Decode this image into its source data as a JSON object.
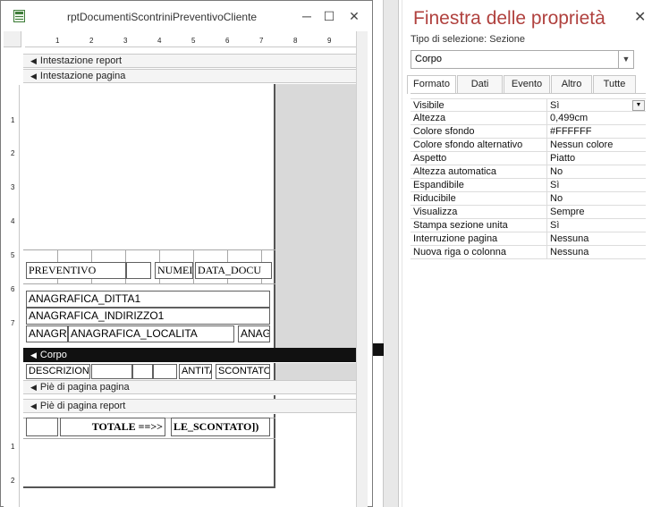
{
  "report_window": {
    "title": "rptDocumentiScontriniPreventivoCliente",
    "minimize_glyph": "─",
    "maximize_glyph": "☐",
    "close_glyph": "✕",
    "icon": "form-icon",
    "ruler_h": [
      "1",
      "2",
      "3",
      "4",
      "5",
      "6",
      "7",
      "8",
      "9"
    ],
    "ruler_v": [
      "1",
      "2",
      "3",
      "4",
      "5",
      "6",
      "7",
      "1",
      "2"
    ],
    "sections": {
      "intestazione_report": "Intestazione report",
      "intestazione_pagina": "Intestazione pagina",
      "corpo": "Corpo",
      "pie_pagina_pagina": "Piè di pagina pagina",
      "pie_pagina_report": "Piè di pagina report"
    },
    "controls": {
      "preventivo": "PREVENTIVO",
      "numero": "NUMEI",
      "data_documento": "DATA_DOCU",
      "ditta": "ANAGRAFICA_DITTA1",
      "indirizzo": "ANAGRAFICA_INDIRIZZO1",
      "anagr_short": "ANAGR",
      "localita": "ANAGRAFICA_LOCALITA",
      "anag_right": "ANAG",
      "descrizione": "DESCRIZIONE_breve",
      "quantita": "ANTITA",
      "scontato": "SCONTATO",
      "totale_label": "TOTALE ==>>",
      "totale_value": "LE_SCONTATO])"
    }
  },
  "property_sheet": {
    "title": "Finestra delle proprietà",
    "close_glyph": "✕",
    "selection_label": "Tipo di selezione:  Sezione",
    "selected_object": "Corpo",
    "tabs": [
      "Formato",
      "Dati",
      "Evento",
      "Altro",
      "Tutte"
    ],
    "active_tab": "Formato",
    "properties": [
      {
        "name": "Visibile",
        "value": "Sì"
      },
      {
        "name": "Altezza",
        "value": "0,499cm"
      },
      {
        "name": "Colore sfondo",
        "value": "#FFFFFF"
      },
      {
        "name": "Colore sfondo alternativo",
        "value": "Nessun colore"
      },
      {
        "name": "Aspetto",
        "value": "Piatto"
      },
      {
        "name": "Altezza automatica",
        "value": "No"
      },
      {
        "name": "Espandibile",
        "value": "Sì"
      },
      {
        "name": "Riducibile",
        "value": "No"
      },
      {
        "name": "Visualizza",
        "value": "Sempre"
      },
      {
        "name": "Stampa sezione unita",
        "value": "Sì"
      },
      {
        "name": "Interruzione pagina",
        "value": "Nessuna"
      },
      {
        "name": "Nuova riga o colonna",
        "value": "Nessuna"
      }
    ]
  },
  "colors": {
    "accent_title": "#b0413e",
    "selected_band": "#111111"
  }
}
